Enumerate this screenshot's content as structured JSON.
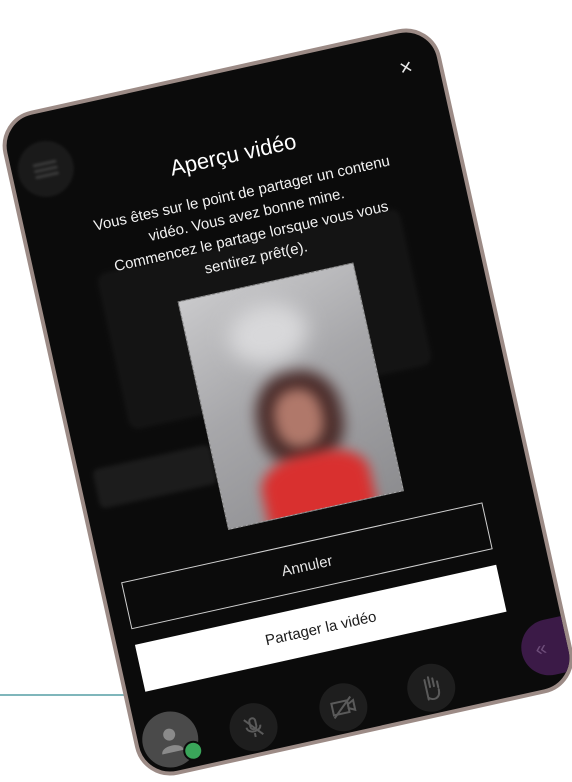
{
  "dialog": {
    "title": "Aperçu vidéo",
    "close_label": "×",
    "message_lines": [
      "Vous êtes sur le point de partager un contenu",
      "vidéo. Vous avez bonne mine.",
      "Commencez le partage lorsque vous vous",
      "sentirez prêt(e)."
    ],
    "cancel_label": "Annuler",
    "share_label": "Partager la vidéo"
  },
  "toolbar": {
    "icons": [
      "avatar-icon",
      "mic-muted-icon",
      "camera-off-icon",
      "raise-hand-icon"
    ],
    "collapse_label": "«"
  },
  "colors": {
    "device_border": "#9c8b86",
    "device_background": "#0b0b0b",
    "accent_teal": "#7fb6bb",
    "status_green": "#3aa55a",
    "collapse_purple": "#3b1a47"
  }
}
